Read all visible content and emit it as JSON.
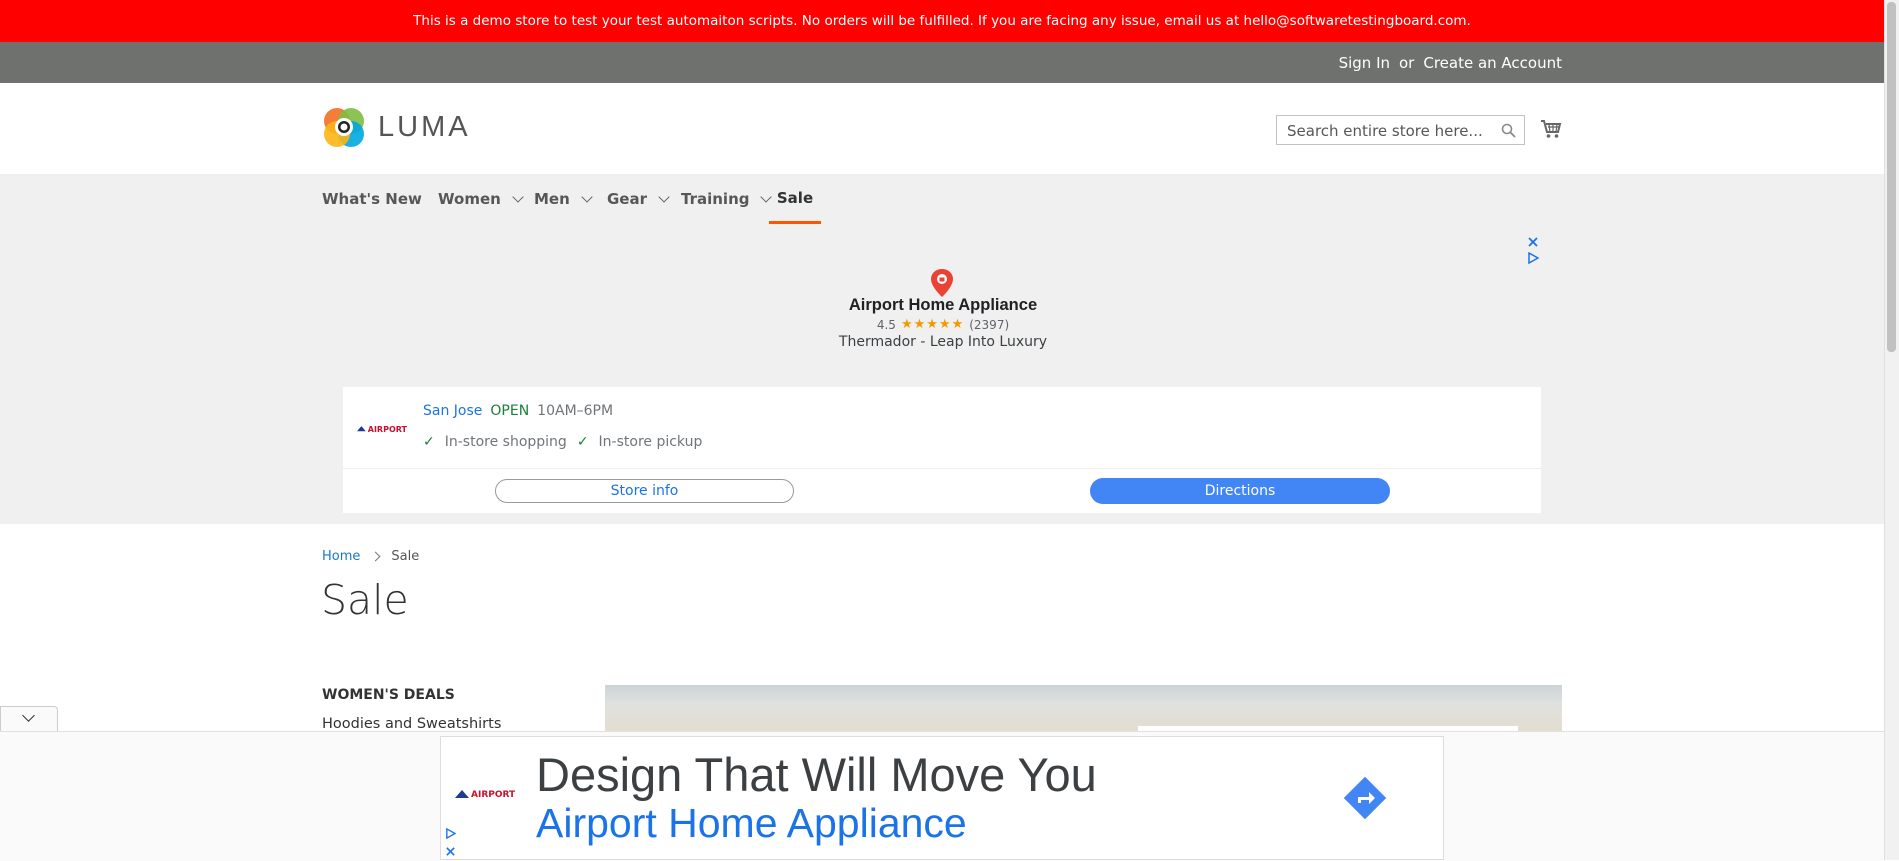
{
  "demo_notice": "This is a demo store to test your test automaiton scripts. No orders will be fulfilled. If you are facing any issue, email us at hello@softwaretestingboard.com.",
  "header_links": {
    "sign_in": "Sign In",
    "or": "or",
    "create_account": "Create an Account"
  },
  "logo": {
    "text": "LUMA"
  },
  "search": {
    "placeholder": "Search entire store here..."
  },
  "nav": [
    {
      "label": "What's New"
    },
    {
      "label": "Women"
    },
    {
      "label": "Men"
    },
    {
      "label": "Gear"
    },
    {
      "label": "Training"
    },
    {
      "label": "Sale"
    }
  ],
  "ad": {
    "business": "Airport Home Appliance",
    "rating": "4.5",
    "reviews": "(2397)",
    "tagline": "Thermador - Leap Into Luxury",
    "city": "San Jose",
    "status": "OPEN",
    "hours": "10AM–6PM",
    "features": [
      "In-store shopping",
      "In-store pickup"
    ],
    "logo_text": "AIRPORT",
    "store_info": "Store info",
    "directions": "Directions"
  },
  "breadcrumb": {
    "home": "Home",
    "current": "Sale"
  },
  "page_title": "Sale",
  "sidebar": {
    "heading": "WOMEN'S DEALS",
    "items": [
      "Hoodies and Sweatshirts"
    ]
  },
  "bottom_ad": {
    "headline": "Design That Will Move You",
    "subline": "Airport Home Appliance",
    "logo_text": "AIRPORT"
  },
  "colors": {
    "demo_bar": "#ff0000",
    "top_links_bar": "#6e716e",
    "link": "#1979c3",
    "active_nav": "#ff5501",
    "ad_blue": "#1a73e8"
  }
}
